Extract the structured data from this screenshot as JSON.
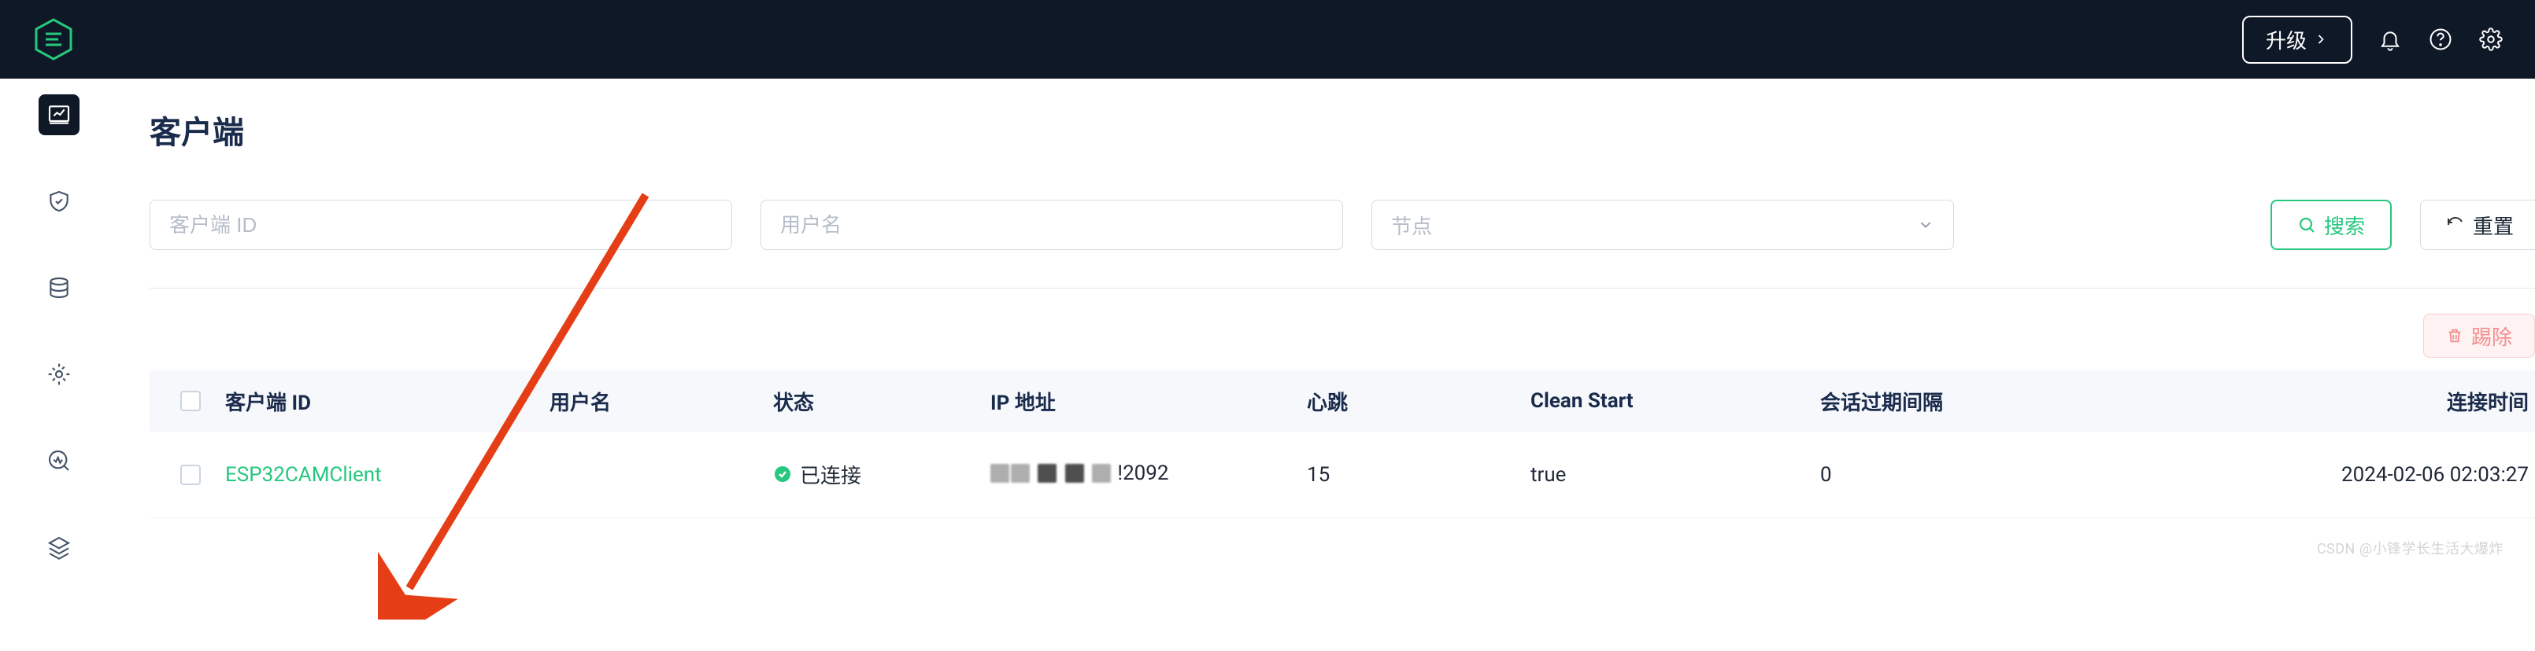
{
  "top": {
    "upgrade_label": "升级"
  },
  "sidebar": {
    "items": [
      {
        "name": "dashboard",
        "active": true
      },
      {
        "name": "security",
        "active": false
      },
      {
        "name": "clusters",
        "active": false
      },
      {
        "name": "rules",
        "active": false
      },
      {
        "name": "monitoring",
        "active": false
      },
      {
        "name": "plugins",
        "active": false
      }
    ]
  },
  "page": {
    "title": "客户端"
  },
  "filters": {
    "client_id_placeholder": "客户端 ID",
    "username_placeholder": "用户名",
    "node_placeholder": "节点",
    "search_label": "搜索",
    "reset_label": "重置"
  },
  "toolbar": {
    "kick_label": "踢除"
  },
  "table": {
    "headers": {
      "client_id": "客户端 ID",
      "username": "用户名",
      "status": "状态",
      "ip": "IP 地址",
      "heartbeat": "心跳",
      "clean_start": "Clean Start",
      "expiry": "会话过期间隔",
      "conn_time": "连接时间"
    },
    "rows": [
      {
        "client_id": "ESP32CAMClient",
        "username": "",
        "status": "已连接",
        "ip_suffix": "!2092",
        "heartbeat": "15",
        "clean_start": "true",
        "expiry": "0",
        "conn_time": "2024-02-06 02:03:27"
      }
    ]
  },
  "watermark": "CSDN @小锋学长生活大爆炸",
  "colors": {
    "accent_green": "#26c77e",
    "bg_dark": "#0f1826",
    "arrow_red": "#e53e16"
  }
}
